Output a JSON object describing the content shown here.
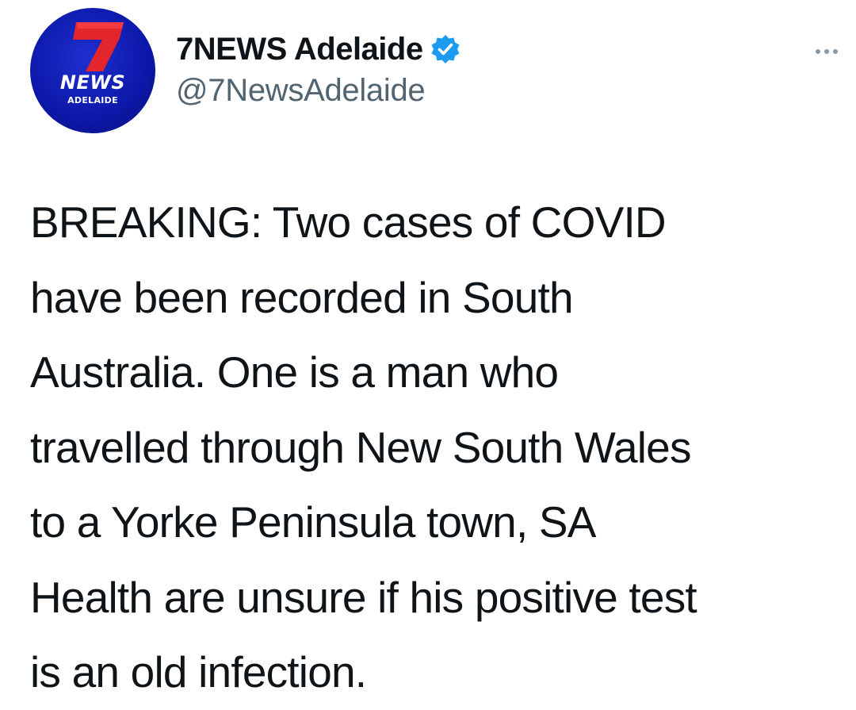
{
  "account": {
    "display_name": "7NEWS Adelaide",
    "handle": "@7NewsAdelaide",
    "verified": true,
    "avatar": {
      "logo_numeral": "7",
      "logo_word": "NEWS",
      "logo_sub": "ADELAIDE",
      "colors": {
        "background": "#0c18a8",
        "numeral": "#e3262b",
        "text": "#ffffff"
      }
    }
  },
  "verified_badge_color": "#1d9bf0",
  "more_icon": "more-options-icon",
  "tweet": {
    "text": "BREAKING: Two cases of COVID\nhave been recorded in South\nAustralia. One is a man who\ntravelled through New South Wales\nto a Yorke Peninsula town, SA\nHealth are unsure if his positive test\nis an old infection."
  }
}
